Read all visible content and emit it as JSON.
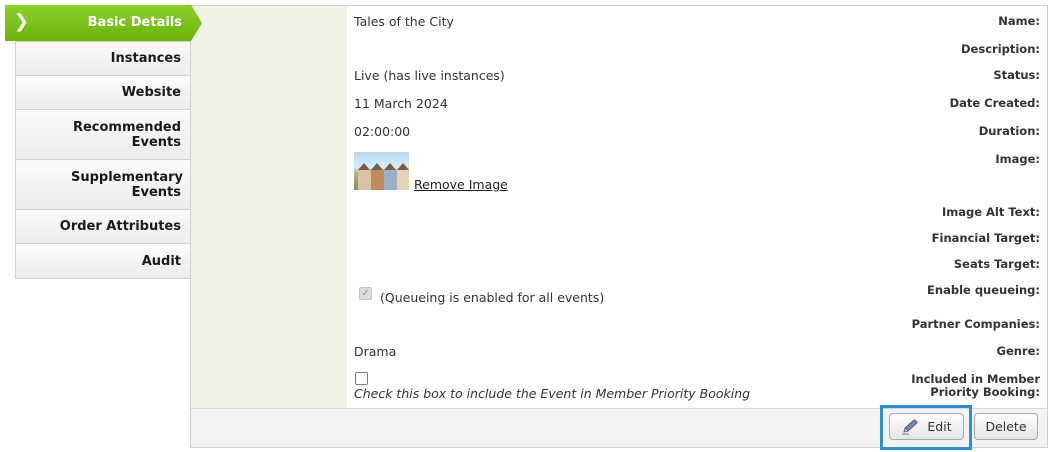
{
  "sidebar": {
    "items": [
      {
        "label": "Basic Details",
        "active": true
      },
      {
        "label": "Instances"
      },
      {
        "label": "Website"
      },
      {
        "label": "Recommended Events"
      },
      {
        "label": "Supplementary Events"
      },
      {
        "label": "Order Attributes"
      },
      {
        "label": "Audit"
      }
    ],
    "active_color": "#7cc21b"
  },
  "details": {
    "name": {
      "label": "Name:",
      "value": "Tales of the City"
    },
    "description": {
      "label": "Description:",
      "value": ""
    },
    "status": {
      "label": "Status:",
      "value": "Live (has live instances)"
    },
    "date_created": {
      "label": "Date Created:",
      "value": "11 March 2024"
    },
    "duration": {
      "label": "Duration:",
      "value": "02:00:00"
    },
    "image": {
      "label": "Image:",
      "remove_link": "Remove Image"
    },
    "image_alt_text": {
      "label": "Image Alt Text:",
      "value": ""
    },
    "financial_target": {
      "label": "Financial Target:",
      "value": ""
    },
    "seats_target": {
      "label": "Seats Target:",
      "value": ""
    },
    "enable_queueing": {
      "label": "Enable queueing:",
      "checked": true,
      "note": "(Queueing is enabled for all events)"
    },
    "partner_companies": {
      "label": "Partner Companies:",
      "value": ""
    },
    "genre": {
      "label": "Genre:",
      "value": "Drama"
    },
    "member_priority": {
      "label_line1": "Included in Member",
      "label_line2": "Priority Booking:",
      "checked": false,
      "hint": "Check this box to include the Event in Member Priority Booking"
    }
  },
  "footer": {
    "edit_label": "Edit",
    "delete_label": "Delete",
    "focus_color": "#2d8fd0"
  }
}
